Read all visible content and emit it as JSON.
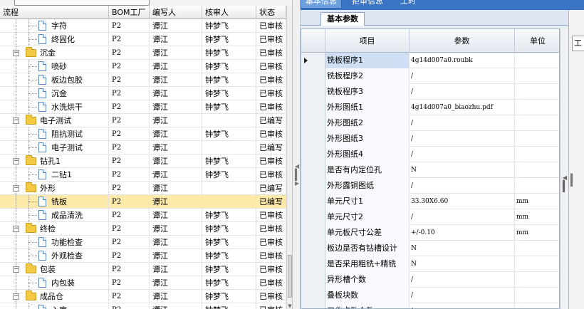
{
  "left_grid": {
    "columns": [
      "流程",
      "BOM工厂",
      "编写人",
      "核审人",
      "状态"
    ],
    "rows": [
      {
        "name": "字符",
        "depth": 2,
        "kind": "doc",
        "bom": "P2",
        "editor": "谭江",
        "reviewer": "钟梦飞",
        "status": "已审核"
      },
      {
        "name": "终固化",
        "depth": 2,
        "kind": "doc",
        "bom": "P2",
        "editor": "谭江",
        "reviewer": "钟梦飞",
        "status": "已审核"
      },
      {
        "name": "沉金",
        "depth": 1,
        "kind": "folder",
        "bom": "P2",
        "editor": "谭江",
        "reviewer": "钟梦飞",
        "status": "已审核"
      },
      {
        "name": "喷砂",
        "depth": 2,
        "kind": "doc",
        "bom": "P2",
        "editor": "谭江",
        "reviewer": "钟梦飞",
        "status": "已审核"
      },
      {
        "name": "板边包胶",
        "depth": 2,
        "kind": "doc",
        "bom": "P2",
        "editor": "谭江",
        "reviewer": "钟梦飞",
        "status": "已审核"
      },
      {
        "name": "沉金",
        "depth": 2,
        "kind": "doc",
        "bom": "P2",
        "editor": "谭江",
        "reviewer": "钟梦飞",
        "status": "已审核"
      },
      {
        "name": "水洗烘干",
        "depth": 2,
        "kind": "doc",
        "bom": "P2",
        "editor": "谭江",
        "reviewer": "钟梦飞",
        "status": "已审核"
      },
      {
        "name": "电子测试",
        "depth": 1,
        "kind": "folder",
        "bom": "P2",
        "editor": "谭江",
        "reviewer": "",
        "status": "已编写"
      },
      {
        "name": "阻抗测试",
        "depth": 2,
        "kind": "doc",
        "bom": "P2",
        "editor": "谭江",
        "reviewer": "钟梦飞",
        "status": "已审核"
      },
      {
        "name": "电子测试",
        "depth": 2,
        "kind": "doc",
        "bom": "P2",
        "editor": "谭江",
        "reviewer": "",
        "status": "已编写"
      },
      {
        "name": "钻孔1",
        "depth": 1,
        "kind": "folder",
        "bom": "P2",
        "editor": "谭江",
        "reviewer": "钟梦飞",
        "status": "已审核"
      },
      {
        "name": "二钻1",
        "depth": 2,
        "kind": "doc",
        "bom": "P2",
        "editor": "谭江",
        "reviewer": "钟梦飞",
        "status": "已审核"
      },
      {
        "name": "外形",
        "depth": 1,
        "kind": "folder",
        "bom": "P2",
        "editor": "谭江",
        "reviewer": "",
        "status": "已编写"
      },
      {
        "name": "铣板",
        "depth": 2,
        "kind": "doc",
        "bom": "P2",
        "editor": "谭江",
        "reviewer": "",
        "status": "已编写",
        "selected": true
      },
      {
        "name": "成品清洗",
        "depth": 2,
        "kind": "doc",
        "bom": "P2",
        "editor": "谭江",
        "reviewer": "钟梦飞",
        "status": "已审核"
      },
      {
        "name": "终检",
        "depth": 1,
        "kind": "folder",
        "bom": "P2",
        "editor": "谭江",
        "reviewer": "钟梦飞",
        "status": "已审核"
      },
      {
        "name": "功能检查",
        "depth": 2,
        "kind": "doc",
        "bom": "P2",
        "editor": "谭江",
        "reviewer": "钟梦飞",
        "status": "已审核"
      },
      {
        "name": "外观检查",
        "depth": 2,
        "kind": "doc",
        "bom": "P2",
        "editor": "谭江",
        "reviewer": "钟梦飞",
        "status": "已审核"
      },
      {
        "name": "包装",
        "depth": 1,
        "kind": "folder",
        "bom": "P2",
        "editor": "谭江",
        "reviewer": "钟梦飞",
        "status": "已审核"
      },
      {
        "name": "内包装",
        "depth": 2,
        "kind": "doc",
        "bom": "P2",
        "editor": "谭江",
        "reviewer": "钟梦飞",
        "status": "已审核"
      },
      {
        "name": "成品仓",
        "depth": 1,
        "kind": "folder",
        "bom": "P2",
        "editor": "谭江",
        "reviewer": "钟梦飞",
        "status": "已审核"
      },
      {
        "name": "入库",
        "depth": 2,
        "kind": "doc",
        "bom": "P2",
        "editor": "谭江",
        "reviewer": "钟梦飞",
        "status": "已审核"
      }
    ]
  },
  "right_panel": {
    "tabs": [
      "基本信息",
      "拒审信息",
      "工时"
    ],
    "subtab": "基本参数",
    "side_label": "工",
    "grid_columns": [
      "项目",
      "参数",
      "单位"
    ],
    "params": [
      {
        "item": "铣板程序1",
        "value": "4g14d007a0.roubk",
        "unit": "",
        "current": true
      },
      {
        "item": "铣板程序2",
        "value": "/",
        "unit": ""
      },
      {
        "item": "铣板程序3",
        "value": "/",
        "unit": ""
      },
      {
        "item": "外形图纸1",
        "value": "4g14d007a0_biaozhu.pdf",
        "unit": ""
      },
      {
        "item": "外形图纸2",
        "value": "/",
        "unit": ""
      },
      {
        "item": "外形图纸3",
        "value": "/",
        "unit": ""
      },
      {
        "item": "外形图纸4",
        "value": "/",
        "unit": ""
      },
      {
        "item": "是否有内定位孔",
        "value": "N",
        "unit": ""
      },
      {
        "item": "外形露铜图纸",
        "value": "/",
        "unit": ""
      },
      {
        "item": "单元尺寸1",
        "value": "33.30X6.60",
        "unit": "mm"
      },
      {
        "item": "单元尺寸2",
        "value": "/",
        "unit": "mm"
      },
      {
        "item": "单元板尺寸公差",
        "value": "+/-0.10",
        "unit": "mm"
      },
      {
        "item": "板边是否有钻槽设计",
        "value": "N",
        "unit": ""
      },
      {
        "item": "是否采用粗铣+精铣",
        "value": "N",
        "unit": ""
      },
      {
        "item": "异形槽个数",
        "value": "/",
        "unit": ""
      },
      {
        "item": "叠板块数",
        "value": "/",
        "unit": ""
      },
      {
        "item": "工作点数个数",
        "value": "/",
        "unit": ""
      }
    ]
  },
  "colors": {
    "selection": "#fde9a8",
    "tab_bar": "#3a74c4",
    "folder": "#f3c842",
    "doc_border": "#5a86c2"
  }
}
